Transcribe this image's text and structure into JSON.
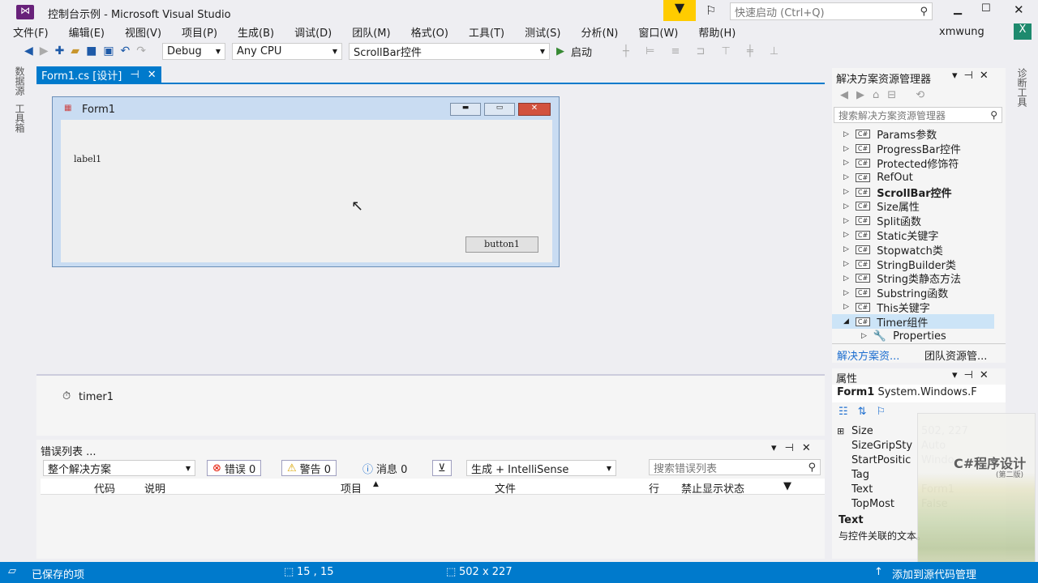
{
  "window": {
    "title": "控制台示例 - Microsoft Visual Studio",
    "quick_launch_placeholder": "快速启动 (Ctrl+Q)",
    "user": "xmwung",
    "user_badge": "X"
  },
  "menu": [
    "文件(F)",
    "编辑(E)",
    "视图(V)",
    "项目(P)",
    "生成(B)",
    "调试(D)",
    "团队(M)",
    "格式(O)",
    "工具(T)",
    "测试(S)",
    "分析(N)",
    "窗口(W)",
    "帮助(H)"
  ],
  "toolbar": {
    "config": "Debug",
    "platform": "Any CPU",
    "startup_project": "ScrollBar控件",
    "start_label": "启动"
  },
  "left_strip": [
    "数据源",
    "工具箱"
  ],
  "right_strip": "诊断工具",
  "doc_tab": {
    "label": "Form1.cs [设计]"
  },
  "designer": {
    "form_title": "Form1",
    "label": "label1",
    "button": "button1",
    "tray_component": "timer1"
  },
  "solution_explorer": {
    "title": "解决方案资源管理器",
    "search_placeholder": "搜索解决方案资源管理器",
    "items": [
      "Params参数",
      "ProgressBar控件",
      "Protected修饰符",
      "RefOut",
      "ScrollBar控件",
      "Size属性",
      "Split函数",
      "Static关键字",
      "Stopwatch类",
      "StringBuilder类",
      "String类静态方法",
      "Substring函数",
      "This关键字",
      "Timer组件"
    ],
    "bold_item": "ScrollBar控件",
    "selected_item": "Timer组件",
    "child": "Properties",
    "tabs": [
      "解决方案资...",
      "团队资源管..."
    ]
  },
  "properties": {
    "title": "属性",
    "object": "Form1",
    "type": "System.Windows.F",
    "rows": [
      {
        "name": "Size",
        "value": "502, 227"
      },
      {
        "name": "SizeGripSty",
        "value": "Auto"
      },
      {
        "name": "StartPositic",
        "value": "Windo"
      },
      {
        "name": "Tag",
        "value": ""
      },
      {
        "name": "Text",
        "value": "Form1"
      },
      {
        "name": "TopMost",
        "value": "False"
      }
    ],
    "desc_title": "Text",
    "desc": "与控件关联的文本。"
  },
  "error_list": {
    "title": "错误列表 ...",
    "scope": "整个解决方案",
    "errors": "错误 0",
    "warnings": "警告 0",
    "messages": "消息 0",
    "build": "生成 + IntelliSense",
    "search_placeholder": "搜索错误列表",
    "columns": [
      "代码",
      "说明",
      "项目",
      "文件",
      "行",
      "禁止显示状态"
    ]
  },
  "status": {
    "left": "已保存的项",
    "position": "15 , 15",
    "size": "502 x 227",
    "source_control": "添加到源代码管理"
  },
  "overlay": {
    "book_title": "C#程序设计",
    "book_edition": "(第二版)"
  },
  "colors": {
    "accent": "#007acc",
    "vs_purple": "#68217a",
    "filter_yellow": "#ffcc00"
  }
}
